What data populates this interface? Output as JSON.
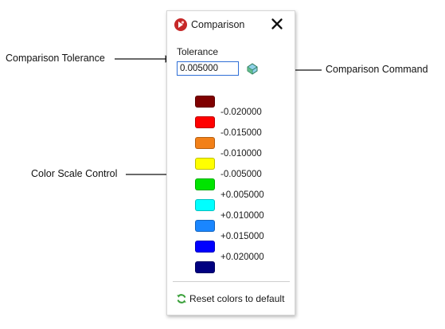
{
  "panel": {
    "title": "Comparison",
    "close_glyph": "✕",
    "tolerance_label": "Tolerance",
    "tolerance_value": "0.005000",
    "reset_label": "Reset colors to default",
    "header_icon": "comparison-app-icon",
    "command_icon": "compare-command-icon",
    "reset_icon": "refresh-icon"
  },
  "color_scale": {
    "swatches": [
      {
        "color": "#7f0000"
      },
      {
        "color": "#ff0000"
      },
      {
        "color": "#f28018"
      },
      {
        "color": "#ffff00"
      },
      {
        "color": "#00e400"
      },
      {
        "color": "#00ffff"
      },
      {
        "color": "#1a86ff"
      },
      {
        "color": "#0000ff"
      },
      {
        "color": "#000080"
      }
    ],
    "values": [
      "-0.020000",
      "-0.015000",
      "-0.010000",
      "-0.005000",
      "+0.005000",
      "+0.010000",
      "+0.015000",
      "+0.020000"
    ]
  },
  "callouts": {
    "tolerance": "Comparison Tolerance",
    "command": "Comparison Command",
    "scale": "Color Scale Control"
  }
}
